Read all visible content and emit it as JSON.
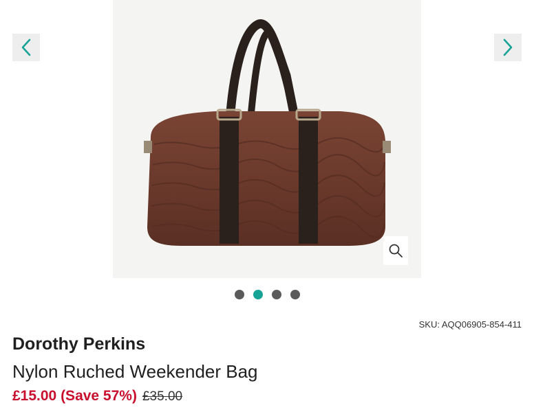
{
  "gallery": {
    "prev_icon": "chevron-left-icon",
    "next_icon": "chevron-right-icon",
    "zoom_icon": "search-icon",
    "product_image_alt": "Nylon Ruched Weekender Bag",
    "dots": [
      {
        "active": false
      },
      {
        "active": true
      },
      {
        "active": false
      },
      {
        "active": false
      }
    ],
    "colors": {
      "accent": "#17a396",
      "arrow": "#17a396",
      "bag": "#6b3a2c",
      "straps": "#2a211c"
    }
  },
  "product": {
    "sku": "SKU: AQQ06905-854-411",
    "brand": "Dorothy Perkins",
    "name": "Nylon Ruched Weekender Bag",
    "price_now": "£15.00 (Save 57%)",
    "price_was": "£35.00",
    "price_color": "#c8102e"
  }
}
